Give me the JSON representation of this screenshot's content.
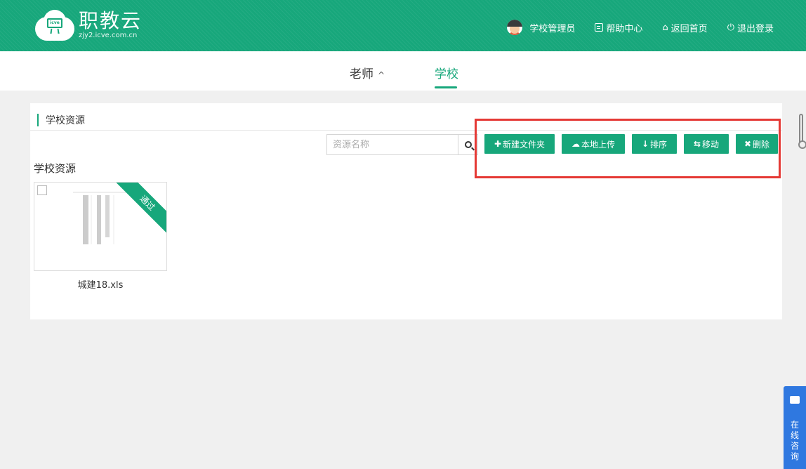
{
  "header": {
    "logo_badge": "icve",
    "logo_title": "职教云",
    "logo_sub": "zjy2.icve.com.cn",
    "user": "学校管理员",
    "help": "帮助中心",
    "home": "返回首页",
    "logout": "退出登录"
  },
  "tabs": [
    {
      "label": "老师",
      "caret": "^"
    },
    {
      "label": "学校",
      "active": true
    }
  ],
  "panel": {
    "title": "学校资源",
    "search_placeholder": "资源名称",
    "buttons": {
      "new_folder": "新建文件夹",
      "upload": "本地上传",
      "sort": "排序",
      "move": "移动",
      "delete": "删除"
    },
    "section_title": "学校资源",
    "files": [
      {
        "name": "城建18.xls",
        "status": "通过"
      }
    ]
  },
  "consult": {
    "label": "在线咨询"
  },
  "colors": {
    "brand": "#17a77b",
    "highlight": "#e53935",
    "consult": "#2f78e0"
  }
}
